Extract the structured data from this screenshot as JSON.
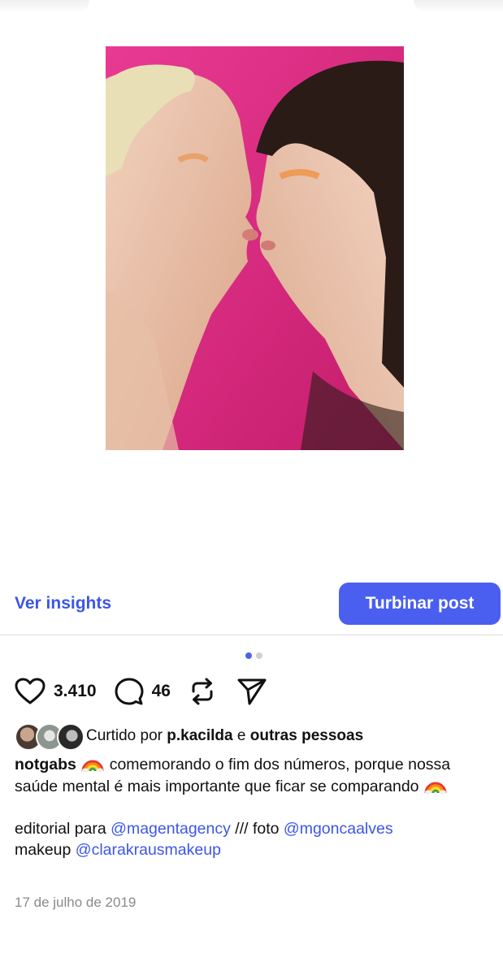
{
  "post": {
    "image_description_icon": "photo",
    "insights_label": "Ver insights",
    "boost_label": "Turbinar post",
    "carousel": {
      "count": 2,
      "active": 1
    },
    "likes_count": "3.410",
    "comments_count": "46",
    "liked_by": {
      "prefix": "Curtido por",
      "user": "p.kacilda",
      "joiner": "e",
      "others": "outras pessoas"
    },
    "caption": {
      "username": "notgabs",
      "text_1": "comemorando o fim dos números, porque nossa saúde mental é mais importante que ficar se comparando",
      "line2_prefix": "editorial para",
      "mention_1": "@magentagency",
      "line2_mid": "/// foto",
      "mention_2": "@mgoncaalves",
      "line3_prefix": "makeup",
      "mention_3": "@clarakrausmakeup"
    },
    "date": "17 de julho de 2019"
  },
  "colors": {
    "accent": "#4a5ff0",
    "link": "#3d56e6",
    "photo_bg": "#d9287f"
  }
}
